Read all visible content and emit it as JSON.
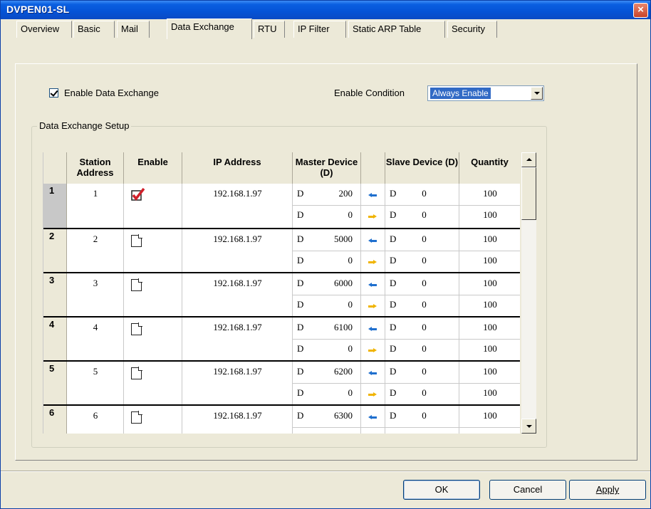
{
  "window": {
    "title": "DVPEN01-SL",
    "close_label": "×"
  },
  "tabs": [
    {
      "label": "Overview",
      "active": false
    },
    {
      "label": "Basic",
      "active": false
    },
    {
      "label": "Mail",
      "active": false
    },
    {
      "label": "Data Exchange",
      "active": true
    },
    {
      "label": "RTU",
      "active": false
    },
    {
      "label": "IP Filter",
      "active": false
    },
    {
      "label": "Static ARP Table",
      "active": false
    },
    {
      "label": "Security",
      "active": false
    }
  ],
  "enable_data_exchange": {
    "label": "Enable Data Exchange",
    "checked": true
  },
  "enable_condition": {
    "label": "Enable Condition",
    "value": "Always Enable"
  },
  "group": {
    "label": "Data Exchange Setup"
  },
  "grid": {
    "headers": {
      "station_address": "Station Address",
      "enable": "Enable",
      "ip_address": "IP Address",
      "master_device": "Master Device (D)",
      "slave_device": "Slave Device (D)",
      "quantity": "Quantity"
    },
    "rows": [
      {
        "num": "1",
        "station": "1",
        "enabled": true,
        "ip": "192.168.1.97",
        "lines": [
          {
            "m_dev": "D",
            "m_addr": "200",
            "dir": "left",
            "s_dev": "D",
            "s_addr": "0",
            "qty": "100"
          },
          {
            "m_dev": "D",
            "m_addr": "0",
            "dir": "right",
            "s_dev": "D",
            "s_addr": "0",
            "qty": "100"
          }
        ]
      },
      {
        "num": "2",
        "station": "2",
        "enabled": false,
        "ip": "192.168.1.97",
        "lines": [
          {
            "m_dev": "D",
            "m_addr": "5000",
            "dir": "left",
            "s_dev": "D",
            "s_addr": "0",
            "qty": "100"
          },
          {
            "m_dev": "D",
            "m_addr": "0",
            "dir": "right",
            "s_dev": "D",
            "s_addr": "0",
            "qty": "100"
          }
        ]
      },
      {
        "num": "3",
        "station": "3",
        "enabled": false,
        "ip": "192.168.1.97",
        "lines": [
          {
            "m_dev": "D",
            "m_addr": "6000",
            "dir": "left",
            "s_dev": "D",
            "s_addr": "0",
            "qty": "100"
          },
          {
            "m_dev": "D",
            "m_addr": "0",
            "dir": "right",
            "s_dev": "D",
            "s_addr": "0",
            "qty": "100"
          }
        ]
      },
      {
        "num": "4",
        "station": "4",
        "enabled": false,
        "ip": "192.168.1.97",
        "lines": [
          {
            "m_dev": "D",
            "m_addr": "6100",
            "dir": "left",
            "s_dev": "D",
            "s_addr": "0",
            "qty": "100"
          },
          {
            "m_dev": "D",
            "m_addr": "0",
            "dir": "right",
            "s_dev": "D",
            "s_addr": "0",
            "qty": "100"
          }
        ]
      },
      {
        "num": "5",
        "station": "5",
        "enabled": false,
        "ip": "192.168.1.97",
        "lines": [
          {
            "m_dev": "D",
            "m_addr": "6200",
            "dir": "left",
            "s_dev": "D",
            "s_addr": "0",
            "qty": "100"
          },
          {
            "m_dev": "D",
            "m_addr": "0",
            "dir": "right",
            "s_dev": "D",
            "s_addr": "0",
            "qty": "100"
          }
        ]
      },
      {
        "num": "6",
        "station": "6",
        "enabled": false,
        "ip": "192.168.1.97",
        "lines": [
          {
            "m_dev": "D",
            "m_addr": "6300",
            "dir": "left",
            "s_dev": "D",
            "s_addr": "0",
            "qty": "100"
          }
        ]
      }
    ]
  },
  "buttons": {
    "ok": "OK",
    "cancel": "Cancel",
    "apply": "Apply"
  },
  "colors": {
    "title_bar": "#0553d6",
    "arrow_master_in": "#1f6fce",
    "arrow_master_out": "#f0b400",
    "check_red": "#d0202a"
  }
}
